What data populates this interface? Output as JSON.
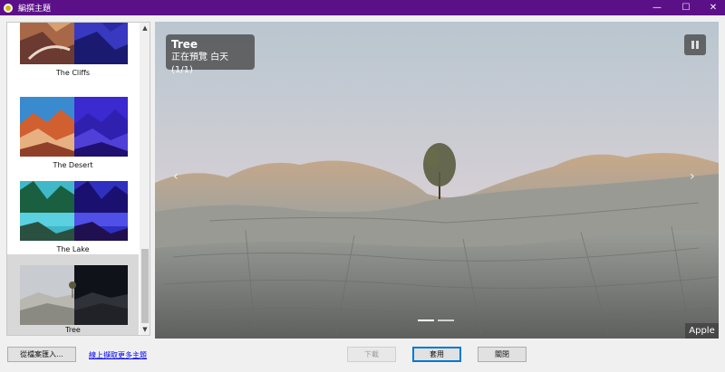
{
  "window": {
    "title": "編撰主題",
    "minimize": "—",
    "maximize": "☐",
    "close": "✕"
  },
  "themes": [
    {
      "label": "The Cliffs"
    },
    {
      "label": "The Desert"
    },
    {
      "label": "The Lake"
    },
    {
      "label": "Tree",
      "selected": true
    }
  ],
  "preview": {
    "title": "Tree",
    "subtitle": "正在預覽 白天 (1/1)",
    "prev_arrow": "‹",
    "next_arrow": "›",
    "credit": "Apple"
  },
  "buttons": {
    "import": "從檔案匯入...",
    "online_link": "線上擷取更多主題",
    "next": "下載",
    "apply": "套用",
    "close": "關閉"
  },
  "colors": {
    "titlebar": "#5c1088",
    "link": "#0000ee",
    "focus": "#0078d7"
  }
}
